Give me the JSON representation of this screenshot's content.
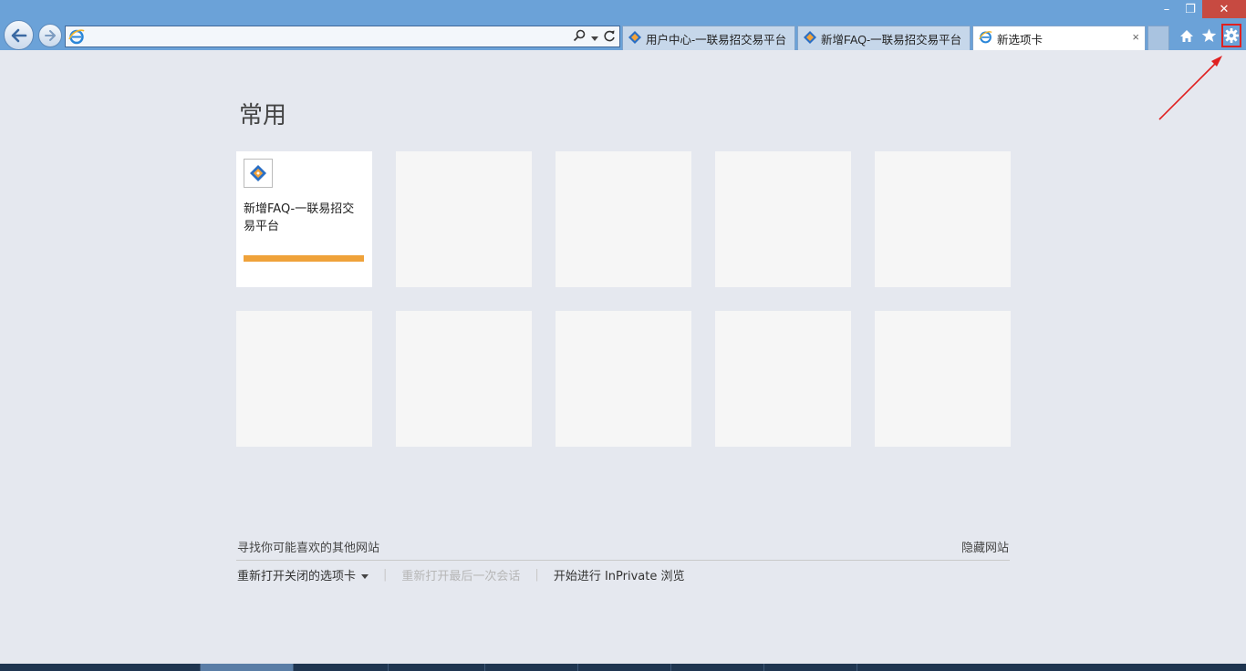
{
  "browser": {
    "address_value": "",
    "tabs": [
      {
        "label": "用户中心-一联易招交易平台"
      },
      {
        "label": "新增FAQ-一联易招交易平台"
      },
      {
        "label": "新选项卡"
      }
    ],
    "tab_close_glyph": "×"
  },
  "window_controls": {
    "minimize": "–",
    "restore": "❐",
    "close": "✕"
  },
  "main": {
    "heading": "常用",
    "tiles": [
      {
        "title": "新增FAQ-一联易招交易平台",
        "icon": "site-logo-icon",
        "accent_color": "#efa23a"
      }
    ]
  },
  "footer": {
    "suggest": "寻找你可能喜欢的其他网站",
    "hide_sites": "隐藏网站",
    "reopen_closed_tabs": "重新打开关闭的选项卡",
    "reopen_last_session": "重新打开最后一次会话",
    "inprivate": "开始进行 InPrivate 浏览"
  },
  "colors": {
    "chrome": "#6ba2d8",
    "content_bg": "#e5e8ef",
    "highlight": "#e02020"
  }
}
